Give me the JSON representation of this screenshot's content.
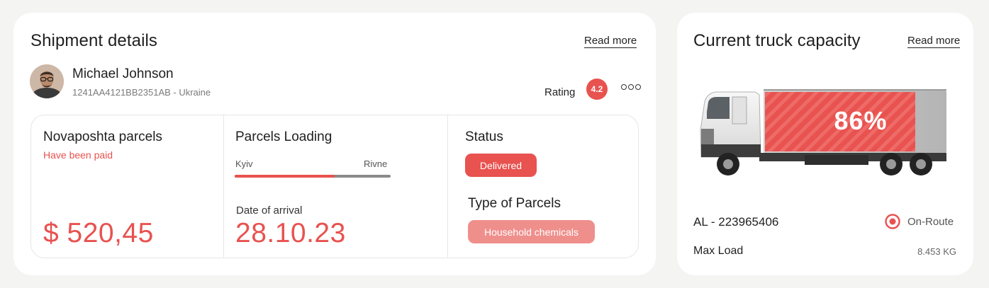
{
  "shipment": {
    "title": "Shipment details",
    "read_more": "Read more",
    "customer": {
      "name": "Michael Johnson",
      "meta": "1241AA4121BB2351AB - Ukraine"
    },
    "rating_label": "Rating",
    "rating_value": "4.2",
    "payment": {
      "title": "Novaposhta parcels",
      "note": "Have been paid",
      "amount": "$ 520,45"
    },
    "loading": {
      "title": "Parcels Loading",
      "from": "Kyiv",
      "to": "Rivne",
      "progress": 0.64,
      "arrival_label": "Date of arrival",
      "arrival_date": "28.10.23"
    },
    "status": {
      "title": "Status",
      "value": "Delivered",
      "type_title": "Type of Parcels",
      "type_value": "Household chemicals"
    }
  },
  "truck": {
    "title": "Current truck capacity",
    "read_more": "Read more",
    "capacity_percent": "86%",
    "plate": "AL - 223965406",
    "route_status": "On-Route",
    "max_load_label": "Max Load",
    "max_load_value": "8.453 KG"
  },
  "colors": {
    "accent": "#e8524f",
    "accent_light": "#ef8f8c",
    "background": "#f4f4f2",
    "card": "#ffffff"
  },
  "icons": {
    "more": "more-horizontal-icon",
    "on_route": "target-icon"
  }
}
